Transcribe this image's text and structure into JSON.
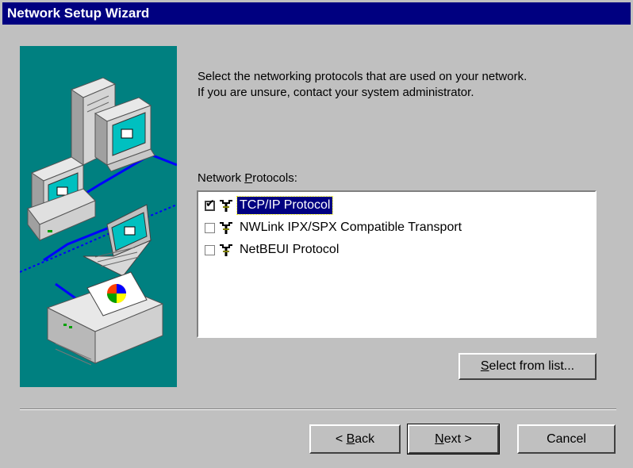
{
  "window": {
    "title": "Network Setup Wizard"
  },
  "instruction": {
    "line1": "Select the networking protocols that are used on your network.",
    "line2": "If you are unsure, contact your system administrator."
  },
  "protocols": {
    "label_pre": "Network ",
    "label_accel": "P",
    "label_post": "rotocols:",
    "items": [
      {
        "label": "TCP/IP Protocol",
        "checked": true,
        "selected": true
      },
      {
        "label": "NWLink IPX/SPX Compatible Transport",
        "checked": false,
        "selected": false
      },
      {
        "label": "NetBEUI Protocol",
        "checked": false,
        "selected": false
      }
    ]
  },
  "buttons": {
    "select_from_list_accel": "S",
    "select_from_list_rest": "elect from list...",
    "back_pre": "< ",
    "back_accel": "B",
    "back_rest": "ack",
    "next_accel": "N",
    "next_rest": "ext >",
    "cancel": "Cancel"
  },
  "colors": {
    "title_bar": "#000080",
    "dialog_bg": "#c0c0c0",
    "image_bg": "#008080",
    "selection": "#000080"
  },
  "icons": {
    "protocol": "network-protocol-icon",
    "check": "checkmark-icon"
  }
}
